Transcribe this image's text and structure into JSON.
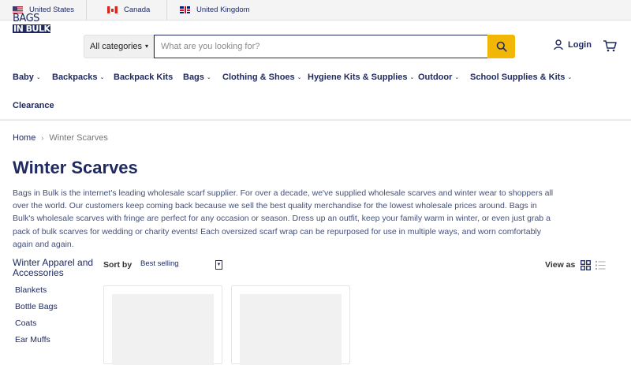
{
  "top_bar": {
    "countries": [
      {
        "label": "United States",
        "flag": "us-flag-icon"
      },
      {
        "label": "Canada",
        "flag": "canada-flag-icon"
      },
      {
        "label": "United Kingdom",
        "flag": "uk-flag-icon"
      }
    ]
  },
  "header": {
    "logo_line1": "BAGS",
    "logo_line2": "IN BULK",
    "category_select": "All categories",
    "search_placeholder": "What are you looking for?",
    "login_label": "Login",
    "search_button_color": "#f2b705"
  },
  "nav": {
    "items": [
      {
        "label": "Baby",
        "caret": "⌄"
      },
      {
        "label": "Backpacks",
        "caret": "⌄"
      },
      {
        "label": "Backpack Kits",
        "caret": ""
      },
      {
        "label": "Bags",
        "caret": "⌄"
      },
      {
        "label": "Clothing & Shoes",
        "caret": "⌄"
      },
      {
        "label": "Hygiene Kits & Supplies",
        "caret": "⌄"
      },
      {
        "label": "Outdoor",
        "caret": "⌄"
      },
      {
        "label": "School Supplies & Kits",
        "caret": "⌄"
      },
      {
        "label": "Clearance",
        "caret": ""
      }
    ]
  },
  "breadcrumb": {
    "home": "Home",
    "separator": "›",
    "current": "Winter Scarves"
  },
  "page": {
    "title": "Winter Scarves",
    "description": "Bags in Bulk is the internet's leading wholesale scarf supplier. For over a decade, we've supplied wholesale scarves and winter wear to shoppers all over the world. Our customers keep coming back because we sell the best quality merchandise for the lowest wholesale prices around. Bags in Bulk's wholesale scarves with fringe are perfect for any occasion or season. Dress up an outfit, keep your family warm in winter, or even just grab a pack of bulk scarves for wedding or charity events! Each oversized scarf wrap can be repurposed for use in multiple ways, and worn comfortably again and again."
  },
  "sidebar": {
    "title": "Winter Apparel and Accessories",
    "items": [
      "Blankets",
      "Bottle Bags",
      "Coats",
      "Ear Muffs"
    ]
  },
  "toolbar": {
    "sort_label": "Sort by",
    "sort_value": "Best selling",
    "view_label": "View as"
  },
  "colors": {
    "brand_navy": "#1f2a60",
    "accent_yellow": "#f2b705"
  }
}
